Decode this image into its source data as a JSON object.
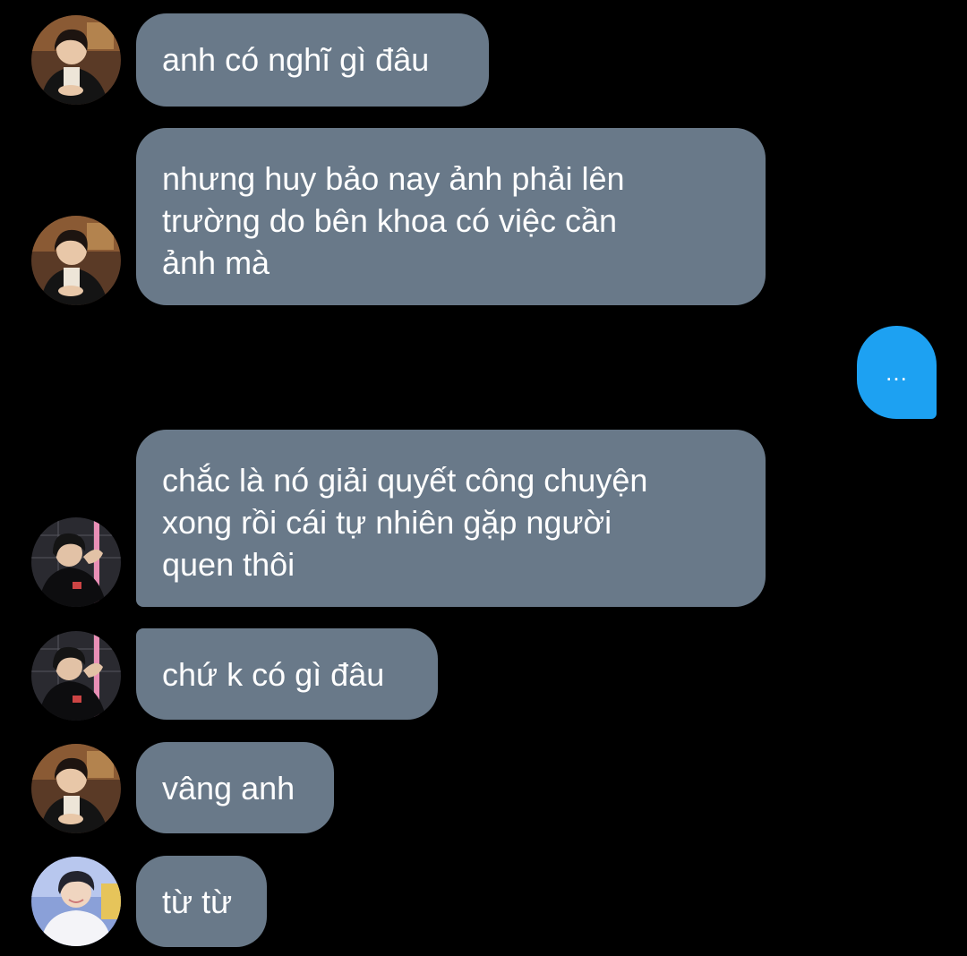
{
  "conversation": {
    "messages": [
      {
        "sender": "user-a",
        "text": "anh có nghĩ gì đâu"
      },
      {
        "sender": "user-a",
        "text": "nhưng huy bảo nay ảnh phải lên\ntrường do bên khoa có việc cần\nảnh mà"
      },
      {
        "sender": "user-b",
        "text": "chắc là nó giải quyết công chuyện\nxong rồi cái tự nhiên gặp người\nquen thôi"
      },
      {
        "sender": "user-b",
        "text": "chứ k có gì đâu"
      },
      {
        "sender": "user-a",
        "text": "vâng anh"
      },
      {
        "sender": "user-c",
        "text": "từ từ"
      }
    ],
    "typing_indicator": "..."
  },
  "colors": {
    "background": "#000000",
    "incoming_bubble": "#697989",
    "outgoing_bubble": "#1da1f2",
    "text": "#ffffff"
  },
  "icons": {
    "avatar_user_a": "person-photo-avatar",
    "avatar_user_b": "person-photo-avatar",
    "avatar_user_c": "person-photo-avatar"
  }
}
